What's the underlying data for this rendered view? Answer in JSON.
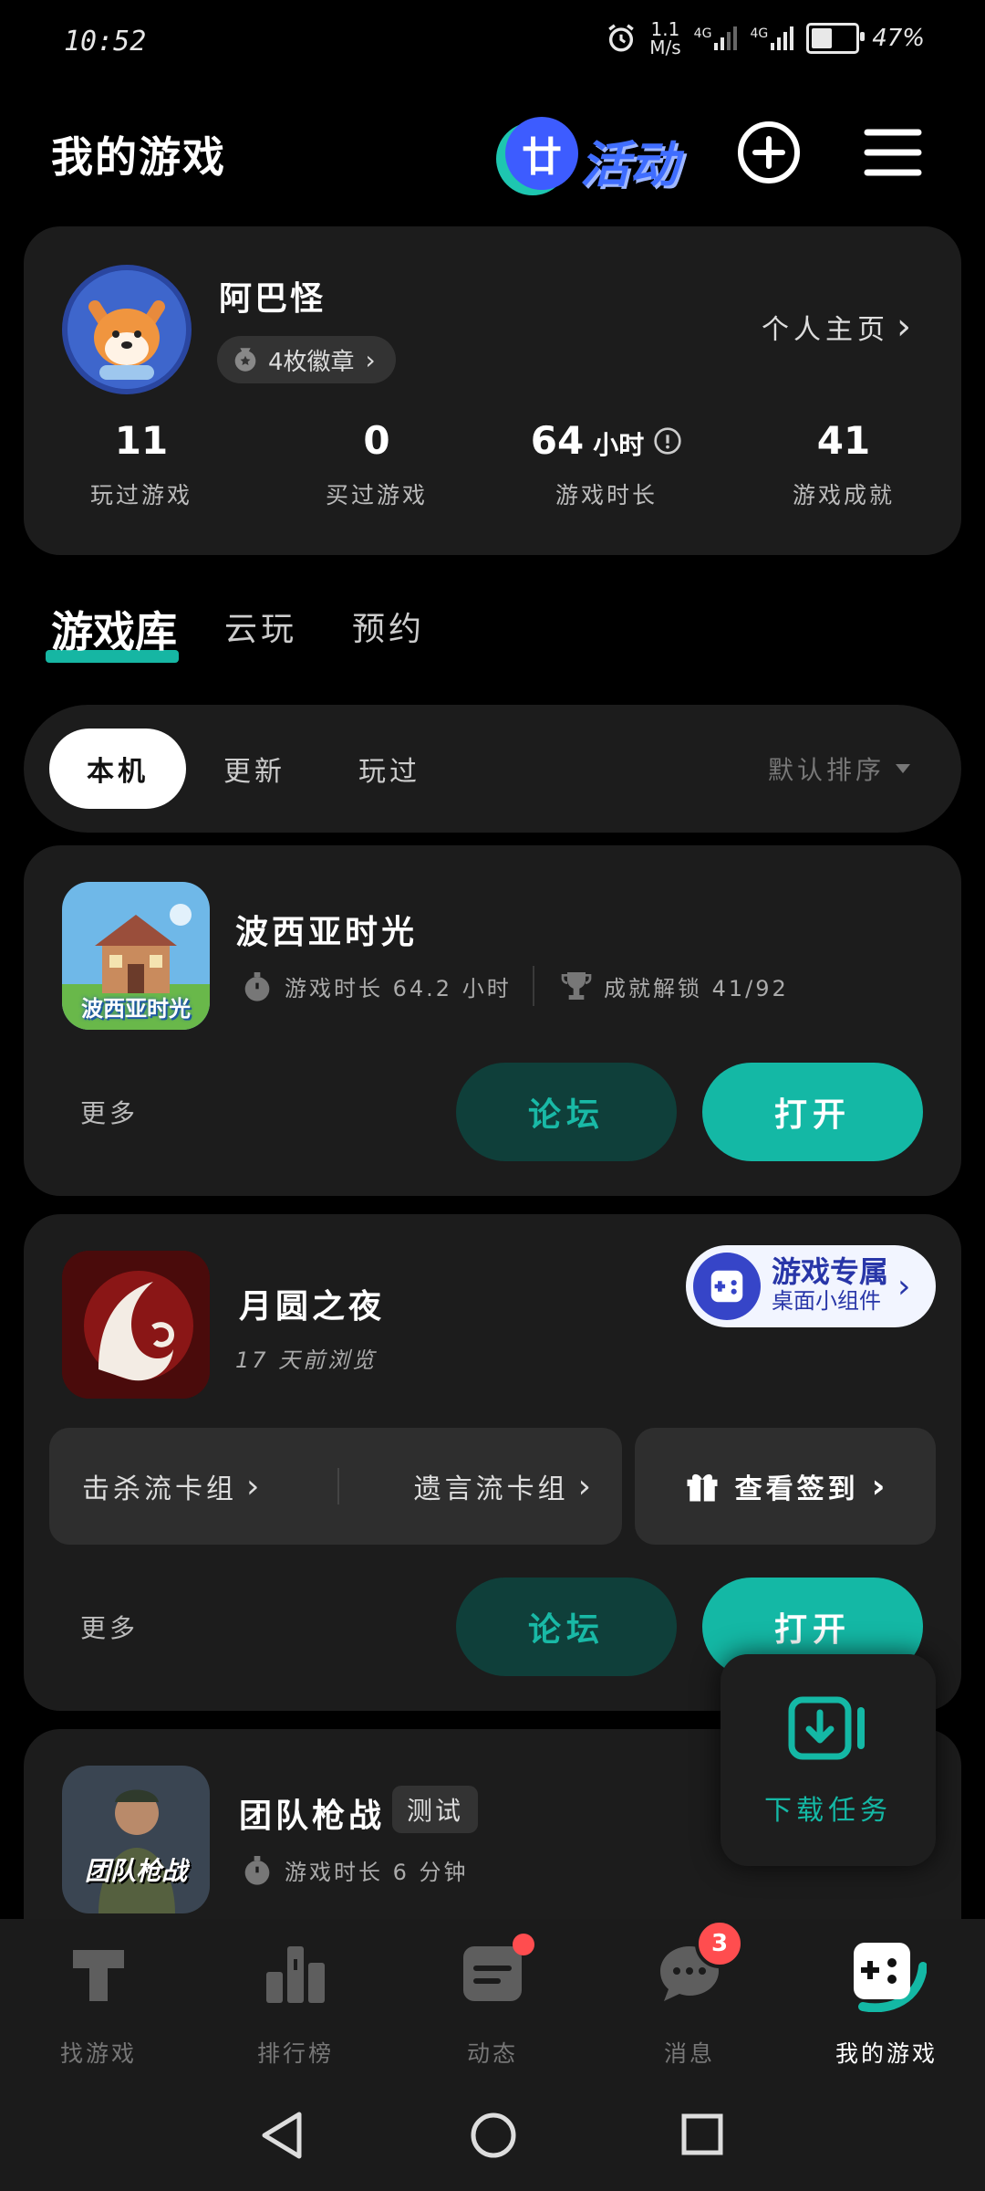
{
  "status_bar": {
    "time": "10:52",
    "speed_value": "1.1",
    "speed_unit": "M/s",
    "net1": "4G",
    "net2": "4G",
    "battery_percent": "47%",
    "battery_level": 0.47
  },
  "header": {
    "title": "我的游戏",
    "activity_label": "活动",
    "activity_badge_glyph": "廿"
  },
  "profile": {
    "username": "阿巴怪",
    "badges_label": "4枚徽章",
    "homepage_link": "个人主页",
    "stats": [
      {
        "value": "11",
        "unit": "",
        "label": "玩过游戏"
      },
      {
        "value": "0",
        "unit": "",
        "label": "买过游戏"
      },
      {
        "value": "64",
        "unit": "小时",
        "label": "游戏时长"
      },
      {
        "value": "41",
        "unit": "",
        "label": "游戏成就"
      }
    ]
  },
  "tabs": [
    {
      "label": "游戏库",
      "active": true
    },
    {
      "label": "云玩",
      "active": false
    },
    {
      "label": "预约",
      "active": false
    }
  ],
  "filters": {
    "chips": [
      "本机",
      "更新",
      "玩过"
    ],
    "sort_label": "默认排序"
  },
  "games": [
    {
      "name": "波西亚时光",
      "playtime": "游戏时长 64.2 小时",
      "achievements": "成就解锁 41/92",
      "more": "更多",
      "forum": "论坛",
      "open": "打开",
      "icon_text": "波西亚时光"
    },
    {
      "name": "月圆之夜",
      "last_viewed": "17 天前浏览",
      "widget_title": "游戏专属",
      "widget_subtitle": "桌面小组件",
      "deck1": "击杀流卡组",
      "deck2": "遗言流卡组",
      "checkin": "查看签到",
      "more": "更多",
      "forum": "论坛",
      "open": "打开"
    },
    {
      "name": "团队枪战",
      "tag": "测试",
      "playtime": "游戏时长 6 分钟",
      "icon_text": "团队枪战"
    }
  ],
  "download_float": {
    "label": "下载任务"
  },
  "bottom_nav": [
    {
      "label": "找游戏",
      "active": false
    },
    {
      "label": "排行榜",
      "active": false
    },
    {
      "label": "动态",
      "active": false
    },
    {
      "label": "消息",
      "active": false,
      "badge": "3"
    },
    {
      "label": "我的游戏",
      "active": true
    }
  ],
  "colors": {
    "accent": "#14b8a5",
    "forum_bg": "#0f3f3a",
    "card_bg": "#1c1c1c",
    "badge_red": "#ff4d4f"
  }
}
